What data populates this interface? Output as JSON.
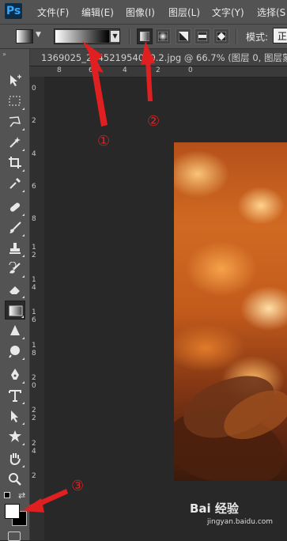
{
  "app": {
    "logo": "Ps"
  },
  "menu": {
    "items": [
      "文件(F)",
      "编辑(E)",
      "图像(I)",
      "图层(L)",
      "文字(Y)",
      "选择(S"
    ]
  },
  "options_bar": {
    "mode_label": "模式:",
    "mode_value": "正"
  },
  "document": {
    "tab_title": "1369025_224521954000.2.jpg @ 66.7% (图层 0, 图层蒙版"
  },
  "rulers": {
    "horizontal": [
      "8",
      "6",
      "4",
      "2",
      "0"
    ],
    "vertical": [
      "0",
      "2",
      "4",
      "6",
      "8",
      "1",
      "2",
      "1",
      "4",
      "1",
      "6",
      "1",
      "8",
      "2",
      "0",
      "2",
      "2",
      "2",
      "4",
      "2"
    ]
  },
  "annotations": {
    "one": "①",
    "two": "②",
    "three": "③"
  },
  "watermark": {
    "text": "Bai 经验",
    "sub": "jingyan.baidu.com"
  },
  "colors": {
    "annotation": "#e02020",
    "foreground": "#ffffff",
    "background": "#000000"
  }
}
